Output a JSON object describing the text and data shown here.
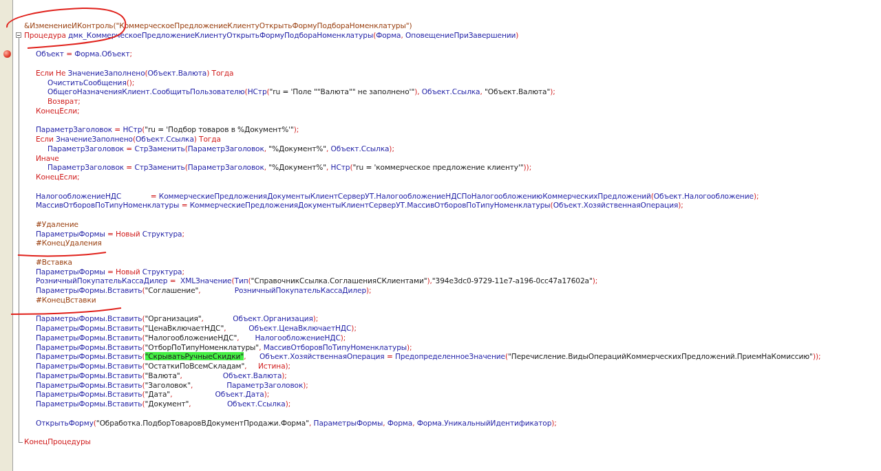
{
  "editor": {
    "procedure": {
      "expanded": true
    },
    "lines": [
      {
        "kind": "code",
        "tokens": [
          {
            "kind": "dir",
            "text": "&ИзменениеИКонтроль(\"КоммерческоеПредложениеКлиентуОткрытьФормуПодбораНоменклатуры\")"
          }
        ]
      },
      {
        "kind": "code",
        "fold_start": true,
        "tokens": [
          {
            "kind": "kw",
            "text": "Процедура "
          },
          {
            "kind": "id",
            "text": "дмк_КоммерческоеПредложениеКлиентуОткрытьФормуПодбораНоменклатуры"
          },
          {
            "kind": "op",
            "text": "("
          },
          {
            "kind": "id",
            "text": "Форма"
          },
          {
            "kind": "op",
            "text": ", "
          },
          {
            "kind": "id",
            "text": "ОповещениеПриЗавершении"
          },
          {
            "kind": "op",
            "text": ")"
          }
        ]
      },
      {
        "kind": "blank"
      },
      {
        "kind": "code",
        "breakpoint": true,
        "tokens": [
          {
            "kind": "id",
            "text": "\tОбъект"
          },
          {
            "kind": "op",
            "text": " = "
          },
          {
            "kind": "id",
            "text": "Форма.Объект"
          },
          {
            "kind": "op",
            "text": ";"
          }
        ]
      },
      {
        "kind": "blank"
      },
      {
        "kind": "code",
        "tokens": [
          {
            "kind": "kw",
            "text": "\tЕсли Не "
          },
          {
            "kind": "id",
            "text": "ЗначениеЗаполнено"
          },
          {
            "kind": "op",
            "text": "("
          },
          {
            "kind": "id",
            "text": "Объект.Валюта"
          },
          {
            "kind": "op",
            "text": ")"
          },
          {
            "kind": "kw",
            "text": " Тогда"
          }
        ]
      },
      {
        "kind": "code",
        "tokens": [
          {
            "kind": "id",
            "text": "\t\tОчиститьСообщения"
          },
          {
            "kind": "op",
            "text": "();"
          }
        ]
      },
      {
        "kind": "code",
        "tokens": [
          {
            "kind": "id",
            "text": "\t\tОбщегоНазначенияКлиент.СообщитьПользователю"
          },
          {
            "kind": "op",
            "text": "("
          },
          {
            "kind": "id",
            "text": "НСтр"
          },
          {
            "kind": "op",
            "text": "("
          },
          {
            "kind": "str",
            "text": "\"ru = 'Поле \"\"Валюта\"\" не заполнено'\""
          },
          {
            "kind": "op",
            "text": "), "
          },
          {
            "kind": "id",
            "text": "Объект.Ссылка"
          },
          {
            "kind": "op",
            "text": ", "
          },
          {
            "kind": "str",
            "text": "\"Объект.Валюта\""
          },
          {
            "kind": "op",
            "text": ");"
          }
        ]
      },
      {
        "kind": "code",
        "tokens": [
          {
            "kind": "kw",
            "text": "\t\tВозврат;"
          }
        ]
      },
      {
        "kind": "code",
        "tokens": [
          {
            "kind": "kw",
            "text": "\tКонецЕсли;"
          }
        ]
      },
      {
        "kind": "blank"
      },
      {
        "kind": "code",
        "tokens": [
          {
            "kind": "id",
            "text": "\tПараметрЗаголовок"
          },
          {
            "kind": "op",
            "text": " = "
          },
          {
            "kind": "id",
            "text": "НСтр"
          },
          {
            "kind": "op",
            "text": "("
          },
          {
            "kind": "str",
            "text": "\"ru = 'Подбор товаров в %Документ%'\""
          },
          {
            "kind": "op",
            "text": ");"
          }
        ]
      },
      {
        "kind": "code",
        "tokens": [
          {
            "kind": "kw",
            "text": "\tЕсли "
          },
          {
            "kind": "id",
            "text": "ЗначениеЗаполнено"
          },
          {
            "kind": "op",
            "text": "("
          },
          {
            "kind": "id",
            "text": "Объект.Ссылка"
          },
          {
            "kind": "op",
            "text": ")"
          },
          {
            "kind": "kw",
            "text": " Тогда"
          }
        ]
      },
      {
        "kind": "code",
        "tokens": [
          {
            "kind": "id",
            "text": "\t\tПараметрЗаголовок"
          },
          {
            "kind": "op",
            "text": " = "
          },
          {
            "kind": "id",
            "text": "СтрЗаменить"
          },
          {
            "kind": "op",
            "text": "("
          },
          {
            "kind": "id",
            "text": "ПараметрЗаголовок"
          },
          {
            "kind": "op",
            "text": ", "
          },
          {
            "kind": "str",
            "text": "\"%Документ%\""
          },
          {
            "kind": "op",
            "text": ", "
          },
          {
            "kind": "id",
            "text": "Объект.Ссылка"
          },
          {
            "kind": "op",
            "text": ");"
          }
        ]
      },
      {
        "kind": "code",
        "tokens": [
          {
            "kind": "kw",
            "text": "\tИначе"
          }
        ]
      },
      {
        "kind": "code",
        "tokens": [
          {
            "kind": "id",
            "text": "\t\tПараметрЗаголовок"
          },
          {
            "kind": "op",
            "text": " = "
          },
          {
            "kind": "id",
            "text": "СтрЗаменить"
          },
          {
            "kind": "op",
            "text": "("
          },
          {
            "kind": "id",
            "text": "ПараметрЗаголовок"
          },
          {
            "kind": "op",
            "text": ", "
          },
          {
            "kind": "str",
            "text": "\"%Документ%\""
          },
          {
            "kind": "op",
            "text": ", "
          },
          {
            "kind": "id",
            "text": "НСтр"
          },
          {
            "kind": "op",
            "text": "("
          },
          {
            "kind": "str",
            "text": "\"ru = 'коммерческое предложение клиенту'\""
          },
          {
            "kind": "op",
            "text": "));"
          }
        ]
      },
      {
        "kind": "code",
        "tokens": [
          {
            "kind": "kw",
            "text": "\tКонецЕсли;"
          }
        ]
      },
      {
        "kind": "blank"
      },
      {
        "kind": "code",
        "tokens": [
          {
            "kind": "id",
            "text": "\tНалогообложениеНДС             "
          },
          {
            "kind": "op",
            "text": "= "
          },
          {
            "kind": "id",
            "text": "КоммерческиеПредложенияДокументыКлиентСерверУТ.НалогообложениеНДСПоНалогообложениюКоммерческихПредложений"
          },
          {
            "kind": "op",
            "text": "("
          },
          {
            "kind": "id",
            "text": "Объект.Налогообложение"
          },
          {
            "kind": "op",
            "text": ");"
          }
        ]
      },
      {
        "kind": "code",
        "tokens": [
          {
            "kind": "id",
            "text": "\tМассивОтборовПоТипуНоменклатуры"
          },
          {
            "kind": "op",
            "text": " = "
          },
          {
            "kind": "id",
            "text": "КоммерческиеПредложенияДокументыКлиентСерверУТ.МассивОтборовПоТипуНоменклатуры"
          },
          {
            "kind": "op",
            "text": "("
          },
          {
            "kind": "id",
            "text": "Объект.ХозяйственнаяОперация"
          },
          {
            "kind": "op",
            "text": ");"
          }
        ]
      },
      {
        "kind": "blank"
      },
      {
        "kind": "code",
        "tokens": [
          {
            "kind": "dir",
            "text": "\t#Удаление"
          }
        ]
      },
      {
        "kind": "code",
        "tokens": [
          {
            "kind": "id",
            "text": "\tПараметрыФормы"
          },
          {
            "kind": "op",
            "text": " = "
          },
          {
            "kind": "kw",
            "text": "Новый "
          },
          {
            "kind": "id",
            "text": "Структура"
          },
          {
            "kind": "op",
            "text": ";"
          }
        ]
      },
      {
        "kind": "code",
        "tokens": [
          {
            "kind": "dir",
            "text": "\t#КонецУдаления"
          }
        ]
      },
      {
        "kind": "blank"
      },
      {
        "kind": "code",
        "tokens": [
          {
            "kind": "dir",
            "text": "\t#Вставка"
          }
        ]
      },
      {
        "kind": "code",
        "tokens": [
          {
            "kind": "id",
            "text": "\tПараметрыФормы"
          },
          {
            "kind": "op",
            "text": " = "
          },
          {
            "kind": "kw",
            "text": "Новый "
          },
          {
            "kind": "id",
            "text": "Структура"
          },
          {
            "kind": "op",
            "text": ";"
          }
        ]
      },
      {
        "kind": "code",
        "tokens": [
          {
            "kind": "id",
            "text": "\tРозничныйПокупательКассаДилер"
          },
          {
            "kind": "op",
            "text": " =  "
          },
          {
            "kind": "id",
            "text": "XMLЗначение"
          },
          {
            "kind": "op",
            "text": "("
          },
          {
            "kind": "id",
            "text": "Тип"
          },
          {
            "kind": "op",
            "text": "("
          },
          {
            "kind": "str",
            "text": "\"СправочникСсылка.СоглашенияСКлиентами\""
          },
          {
            "kind": "op",
            "text": "),"
          },
          {
            "kind": "str",
            "text": "\"394e3dc0-9729-11e7-a196-0cc47a17602a\""
          },
          {
            "kind": "op",
            "text": ");"
          }
        ]
      },
      {
        "kind": "code",
        "tokens": [
          {
            "kind": "id",
            "text": "\tПараметрыФормы.Вставить"
          },
          {
            "kind": "op",
            "text": "("
          },
          {
            "kind": "str",
            "text": "\"Соглашение\""
          },
          {
            "kind": "op",
            "text": ",               "
          },
          {
            "kind": "id",
            "text": "РозничныйПокупательКассаДилер"
          },
          {
            "kind": "op",
            "text": ");"
          }
        ]
      },
      {
        "kind": "code",
        "tokens": [
          {
            "kind": "dir",
            "text": "\t#КонецВставки"
          }
        ]
      },
      {
        "kind": "blank"
      },
      {
        "kind": "code",
        "tokens": [
          {
            "kind": "id",
            "text": "\tПараметрыФормы.Вставить"
          },
          {
            "kind": "op",
            "text": "("
          },
          {
            "kind": "str",
            "text": "\"Организация\""
          },
          {
            "kind": "op",
            "text": ",             "
          },
          {
            "kind": "id",
            "text": "Объект.Организация"
          },
          {
            "kind": "op",
            "text": ");"
          }
        ]
      },
      {
        "kind": "code",
        "tokens": [
          {
            "kind": "id",
            "text": "\tПараметрыФормы.Вставить"
          },
          {
            "kind": "op",
            "text": "("
          },
          {
            "kind": "str",
            "text": "\"ЦенаВключаетНДС\""
          },
          {
            "kind": "op",
            "text": ",          "
          },
          {
            "kind": "id",
            "text": "Объект.ЦенаВключаетНДС"
          },
          {
            "kind": "op",
            "text": ");"
          }
        ]
      },
      {
        "kind": "code",
        "tokens": [
          {
            "kind": "id",
            "text": "\tПараметрыФормы.Вставить"
          },
          {
            "kind": "op",
            "text": "("
          },
          {
            "kind": "str",
            "text": "\"НалогообложениеНДС\""
          },
          {
            "kind": "op",
            "text": ",       "
          },
          {
            "kind": "id",
            "text": "НалогообложениеНДС"
          },
          {
            "kind": "op",
            "text": ");"
          }
        ]
      },
      {
        "kind": "code",
        "tokens": [
          {
            "kind": "id",
            "text": "\tПараметрыФормы.Вставить"
          },
          {
            "kind": "op",
            "text": "("
          },
          {
            "kind": "str",
            "text": "\"ОтборПоТипуНоменклатуры\""
          },
          {
            "kind": "op",
            "text": ", "
          },
          {
            "kind": "id",
            "text": "МассивОтборовПоТипуНоменклатуры"
          },
          {
            "kind": "op",
            "text": ");"
          }
        ]
      },
      {
        "kind": "code",
        "tokens": [
          {
            "kind": "id",
            "text": "\tПараметрыФормы.Вставить"
          },
          {
            "kind": "op",
            "text": "("
          },
          {
            "kind": "str",
            "text": "\"СкрыватьРучныеСкидки\"",
            "highlighted": true
          },
          {
            "kind": "op",
            "text": ",      "
          },
          {
            "kind": "id",
            "text": "Объект.ХозяйственнаяОперация"
          },
          {
            "kind": "op",
            "text": " = "
          },
          {
            "kind": "id",
            "text": "ПредопределенноеЗначение"
          },
          {
            "kind": "op",
            "text": "("
          },
          {
            "kind": "str",
            "text": "\"Перечисление.ВидыОперацийКоммерческихПредложений.ПриемНаКомиссию\""
          },
          {
            "kind": "op",
            "text": "));"
          }
        ]
      },
      {
        "kind": "code",
        "tokens": [
          {
            "kind": "id",
            "text": "\tПараметрыФормы.Вставить"
          },
          {
            "kind": "op",
            "text": "("
          },
          {
            "kind": "str",
            "text": "\"ОстаткиПоВсемСкладам\""
          },
          {
            "kind": "op",
            "text": ",     "
          },
          {
            "kind": "kw",
            "text": "Истина"
          },
          {
            "kind": "op",
            "text": ");"
          }
        ]
      },
      {
        "kind": "code",
        "tokens": [
          {
            "kind": "id",
            "text": "\tПараметрыФормы.Вставить"
          },
          {
            "kind": "op",
            "text": "("
          },
          {
            "kind": "str",
            "text": "\"Валюта\""
          },
          {
            "kind": "op",
            "text": ",                  "
          },
          {
            "kind": "id",
            "text": "Объект.Валюта"
          },
          {
            "kind": "op",
            "text": ");"
          }
        ]
      },
      {
        "kind": "code",
        "tokens": [
          {
            "kind": "id",
            "text": "\tПараметрыФормы.Вставить"
          },
          {
            "kind": "op",
            "text": "("
          },
          {
            "kind": "str",
            "text": "\"Заголовок\""
          },
          {
            "kind": "op",
            "text": ",               "
          },
          {
            "kind": "id",
            "text": "ПараметрЗаголовок"
          },
          {
            "kind": "op",
            "text": ");"
          }
        ]
      },
      {
        "kind": "code",
        "tokens": [
          {
            "kind": "id",
            "text": "\tПараметрыФормы.Вставить"
          },
          {
            "kind": "op",
            "text": "("
          },
          {
            "kind": "str",
            "text": "\"Дата\""
          },
          {
            "kind": "op",
            "text": ",                   "
          },
          {
            "kind": "id",
            "text": "Объект.Дата"
          },
          {
            "kind": "op",
            "text": ");"
          }
        ]
      },
      {
        "kind": "code",
        "tokens": [
          {
            "kind": "id",
            "text": "\tПараметрыФормы.Вставить"
          },
          {
            "kind": "op",
            "text": "("
          },
          {
            "kind": "str",
            "text": "\"Документ\""
          },
          {
            "kind": "op",
            "text": ",                "
          },
          {
            "kind": "id",
            "text": "Объект.Ссылка"
          },
          {
            "kind": "op",
            "text": ");"
          }
        ]
      },
      {
        "kind": "blank"
      },
      {
        "kind": "code",
        "tokens": [
          {
            "kind": "id",
            "text": "\tОткрытьФорму"
          },
          {
            "kind": "op",
            "text": "("
          },
          {
            "kind": "str",
            "text": "\"Обработка.ПодборТоваровВДокументПродажи.Форма\""
          },
          {
            "kind": "op",
            "text": ", "
          },
          {
            "kind": "id",
            "text": "ПараметрыФормы"
          },
          {
            "kind": "op",
            "text": ", "
          },
          {
            "kind": "id",
            "text": "Форма"
          },
          {
            "kind": "op",
            "text": ", "
          },
          {
            "kind": "id",
            "text": "Форма.УникальныйИдентификатор"
          },
          {
            "kind": "op",
            "text": ");"
          }
        ]
      },
      {
        "kind": "blank"
      },
      {
        "kind": "code",
        "fold_end": true,
        "tokens": [
          {
            "kind": "kw",
            "text": "КонецПроцедуры"
          }
        ]
      }
    ]
  }
}
